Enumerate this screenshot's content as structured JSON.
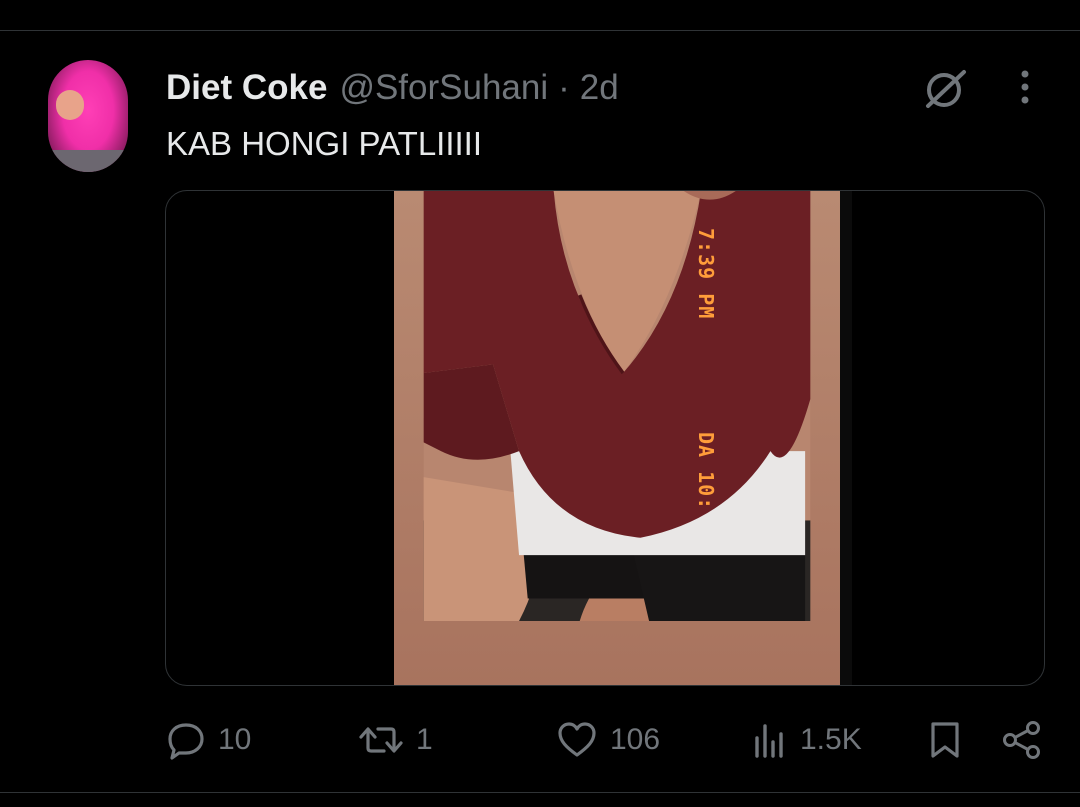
{
  "tweet": {
    "display_name": "Diet Coke",
    "handle": "@SforSuhani",
    "separator": "·",
    "time": "2d",
    "text": "KAB HONGI PATLIIIII"
  },
  "media": {
    "stamp_time": "7:39 PM",
    "stamp_date": "DA 10:"
  },
  "actions": {
    "reply_count": "10",
    "repost_count": "1",
    "like_count": "106",
    "views_count": "1.5K"
  },
  "icons": {
    "grok": "grok-icon",
    "more": "more-icon",
    "reply": "reply-icon",
    "repost": "repost-icon",
    "like": "heart-icon",
    "views": "views-icon",
    "bookmark": "bookmark-icon",
    "share": "share-icon"
  },
  "colors": {
    "background": "#000000",
    "text_primary": "#e7e9ea",
    "text_secondary": "#71767b",
    "border": "#2f3336",
    "timestamp_orange": "#ff9d3a"
  }
}
